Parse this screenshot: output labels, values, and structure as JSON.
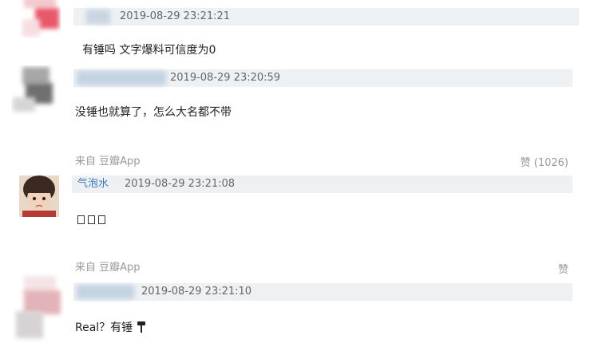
{
  "comments": [
    {
      "timestamp": "2019-08-29 23:21:21",
      "text": "有锤吗 文字爆料可信度为0",
      "avatar_color": "#e8586a"
    },
    {
      "timestamp": "2019-08-29 23:20:59",
      "text": "没锤也就算了，怎么大名都不带",
      "source": "来自 豆瓣App",
      "likes": "赞 (1026)",
      "avatar_color": "#8c8c8c"
    },
    {
      "username": "气泡水",
      "timestamp": "2019-08-29 23:21:08",
      "text": "",
      "source": "来自 豆瓣App",
      "likes": "赞"
    },
    {
      "timestamp": "2019-08-29 23:21:10",
      "text": "Real？有锤",
      "avatar_color": "#e2b3b8"
    }
  ],
  "colors": {
    "meta_strip": "#eef1f4",
    "link": "#3d78b5",
    "muted": "#999999"
  }
}
